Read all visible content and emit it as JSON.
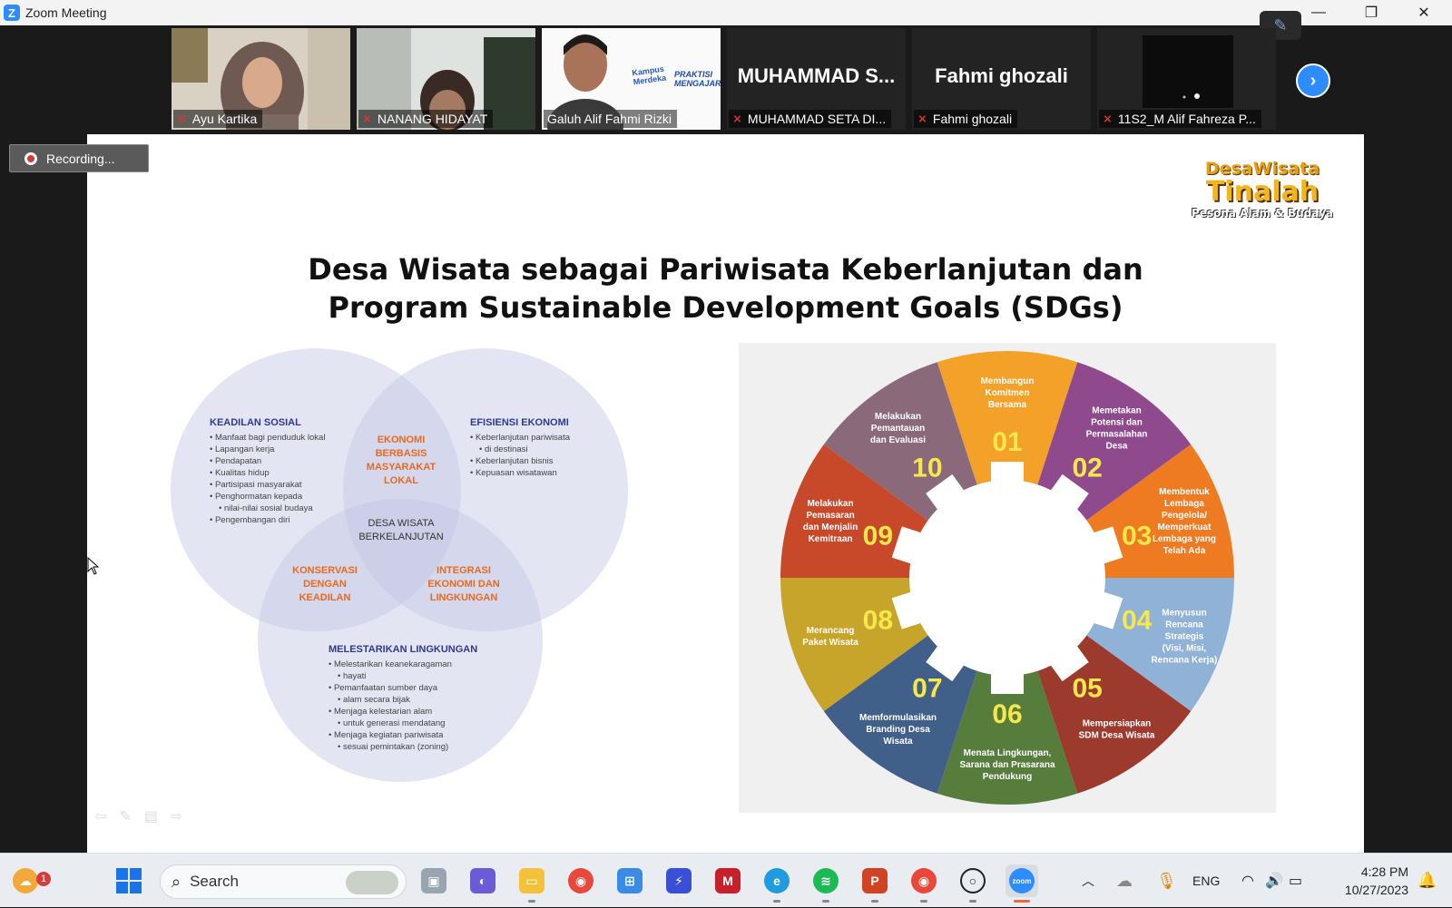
{
  "window": {
    "title": "Zoom Meeting"
  },
  "gallery": {
    "participants": [
      {
        "name": "Ayu Kartika",
        "muted": true,
        "video": true
      },
      {
        "name": "NANANG HIDAYAT",
        "muted": true,
        "video": true
      },
      {
        "name": "Galuh Alif Fahmi Rizki",
        "muted": false,
        "video": true,
        "active": true
      },
      {
        "name": "MUHAMMAD SETA DI...",
        "display": "MUHAMMAD  S...",
        "muted": true,
        "video": false
      },
      {
        "name": "Fahmi ghozali",
        "display": "Fahmi ghozali",
        "muted": true,
        "video": false
      },
      {
        "name": "11S2_M Alif Fahreza P...",
        "muted": true,
        "video": true
      }
    ],
    "background_badge": {
      "line1": "Kampus",
      "line2": "Merdeka",
      "line3": "PRAKTISI",
      "line4": "MENGAJAR"
    }
  },
  "recording": {
    "label": "Recording..."
  },
  "slide": {
    "logo": {
      "line1": "DesaWisata",
      "line2": "Tinalah",
      "line3": "Pesona Alam & Budaya"
    },
    "title_line1": "Desa Wisata sebagai Pariwisata Keberlanjutan dan",
    "title_line2": "Program Sustainable Development Goals (SDGs)",
    "venn": {
      "social": {
        "heading": "KEADILAN SOSIAL",
        "items": [
          "Manfaat bagi penduduk lokal",
          "Lapangan kerja",
          "Pendapatan",
          "Kualitas hidup",
          "Partisipasi masyarakat",
          "Penghormatan kepada",
          "nilai-nilai sosial budaya",
          "Pengembangan diri"
        ]
      },
      "economy": {
        "heading": "EFISIENSI EKONOMI",
        "items": [
          "Keberlanjutan pariwisata",
          "di destinasi",
          "Keberlanjutan bisnis",
          "Kepuasan wisatawan"
        ]
      },
      "environment": {
        "heading": "MELESTARIKAN LINGKUNGAN",
        "items": [
          "Melestarikan keanekaragaman",
          "hayati",
          "Pemanfaatan sumber daya",
          "alam secara bijak",
          "Menjaga kelestarian alam",
          "untuk generasi mendatang",
          "Menjaga kegiatan pariwisata",
          "sesuai pemintakan (zoning)"
        ]
      },
      "overlap_social_economy": [
        "EKONOMI",
        "BERBASIS",
        "MASYARAKAT",
        "LOKAL"
      ],
      "overlap_social_environment": [
        "KONSERVASI",
        "DENGAN",
        "KEADILAN"
      ],
      "overlap_economy_environment": [
        "INTEGRASI",
        "EKONOMI DAN",
        "LINGKUNGAN"
      ],
      "center": [
        "DESA WISATA",
        "BERKELANJUTAN"
      ]
    },
    "wheel": {
      "segments": [
        {
          "num": "01",
          "color": "#f4a12a",
          "lines": [
            "Membangun",
            "Komitmen",
            "Bersama"
          ]
        },
        {
          "num": "02",
          "color": "#8e4a8c",
          "lines": [
            "Memetakan",
            "Potensi dan",
            "Permasalahan",
            "Desa"
          ]
        },
        {
          "num": "03",
          "color": "#ee7a22",
          "lines": [
            "Membentuk",
            "Lembaga",
            "Pengelola/",
            "Memperkuat",
            "Lembaga yang",
            "Telah Ada"
          ]
        },
        {
          "num": "04",
          "color": "#8fb2d6",
          "lines": [
            "Menyusun",
            "Rencana",
            "Strategis",
            "(Visi, Misi,",
            "Rencana Kerja)"
          ]
        },
        {
          "num": "05",
          "color": "#9c3a2e",
          "lines": [
            "Mempersiapkan",
            "SDM Desa Wisata"
          ]
        },
        {
          "num": "06",
          "color": "#567d3c",
          "lines": [
            "Menata Lingkungan,",
            "Sarana dan Prasarana",
            "Pendukung"
          ]
        },
        {
          "num": "07",
          "color": "#40608a",
          "lines": [
            "Memformulasikan",
            "Branding Desa",
            "Wisata"
          ]
        },
        {
          "num": "08",
          "color": "#c7a42a",
          "lines": [
            "Merancang",
            "Paket Wisata"
          ]
        },
        {
          "num": "09",
          "color": "#c8482a",
          "lines": [
            "Melakukan",
            "Pemasaran",
            "dan Menjalin",
            "Kemitraan"
          ]
        },
        {
          "num": "10",
          "color": "#8a6a7a",
          "lines": [
            "Melakukan",
            "Pemantauan",
            "dan Evaluasi"
          ]
        }
      ]
    }
  },
  "taskbar": {
    "search_label": "Search",
    "notification_count": "1",
    "language": "ENG",
    "time": "4:28 PM",
    "date": "10/27/2023",
    "icons": [
      "widgets-icon",
      "windows-start-icon",
      "task-view-icon",
      "teams-chat-icon",
      "file-explorer-icon",
      "chrome-icon",
      "microsoft-store-icon",
      "powerautomate-icon",
      "mcafee-icon",
      "edge-icon",
      "spotify-icon",
      "powerpoint-icon",
      "chrome-profile-icon",
      "obs-icon",
      "zoom-icon"
    ]
  }
}
